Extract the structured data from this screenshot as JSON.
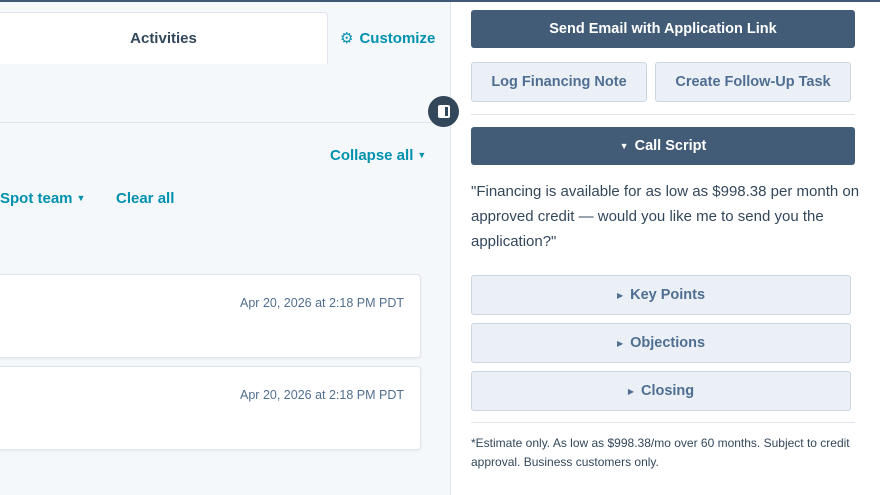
{
  "left": {
    "tab_activities": "Activities",
    "customize_label": "Customize",
    "collapse_all_label": "Collapse all",
    "team_filter_label": "Spot team",
    "clear_all_label": "Clear all",
    "activities": [
      {
        "timestamp": "Apr 20, 2026 at 2:18 PM PDT"
      },
      {
        "timestamp": "Apr 20, 2026 at 2:18 PM PDT"
      }
    ]
  },
  "right": {
    "send_email_label": "Send Email with Application Link",
    "log_note_label": "Log Financing Note",
    "follow_up_label": "Create Follow-Up Task",
    "call_script_label": "Call Script",
    "call_script_text": "\"Financing is available for as low as $998.38 per month on approved credit — would you like me to send you the application?\"",
    "sections": [
      {
        "label": "Key Points"
      },
      {
        "label": "Objections"
      },
      {
        "label": "Closing"
      }
    ],
    "disclaimer": "*Estimate only. As low as $998.38/mo over 60 months. Subject to credit approval. Business customers only."
  },
  "icons": {
    "customize": "gear-icon",
    "panel_toggle": "sidebar-toggle-icon",
    "dropdown": "caret-down-icon",
    "expanded": "triangle-down-icon",
    "collapsed": "triangle-right-icon"
  },
  "colors": {
    "primary_button": "#425b76",
    "link": "#0091ae",
    "secondary_button_bg": "#eaf0f6",
    "text": "#33475b"
  }
}
